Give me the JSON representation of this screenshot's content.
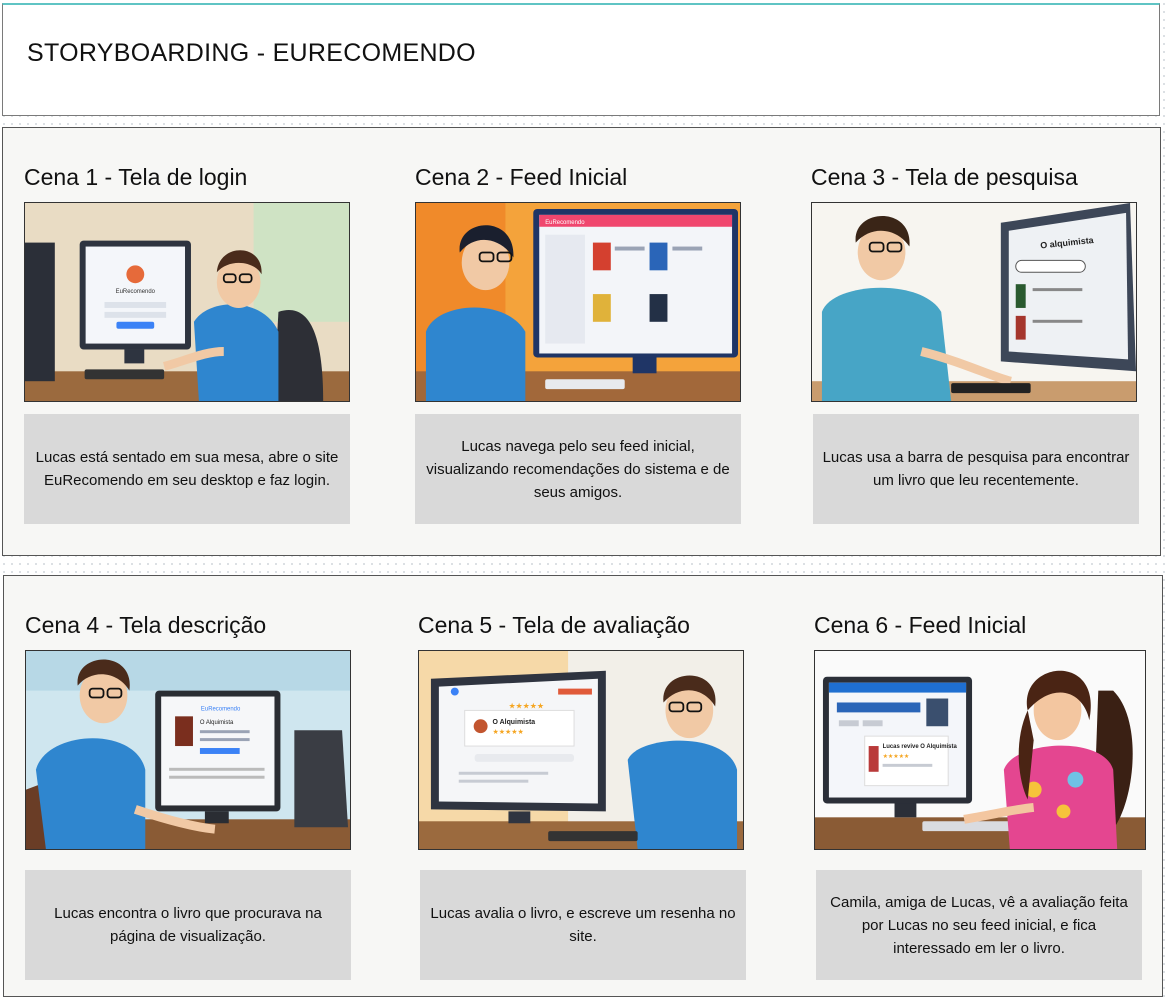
{
  "page": {
    "title": "STORYBOARDING - EURECOMENDO"
  },
  "scenes": [
    {
      "title": "Cena 1 - Tela de login",
      "caption": "Lucas está sentado em sua mesa, abre o site EuRecomendo em seu desktop e faz login.",
      "screen_text": "EuRecomendo"
    },
    {
      "title": "Cena 2 - Feed Inicial",
      "caption": "Lucas navega pelo seu feed inicial, visualizando recomendações do sistema e de seus amigos.",
      "screen_text": "EuRecomendo"
    },
    {
      "title": "Cena 3 - Tela de pesquisa",
      "caption": "Lucas usa a barra de pesquisa para encontrar um livro que leu recentemente.",
      "screen_text": "O alquimista"
    },
    {
      "title": "Cena 4 - Tela descrição",
      "caption": "Lucas encontra o livro que procurava na página de visualização.",
      "screen_text": "O Alquimista"
    },
    {
      "title": "Cena 5 - Tela de avaliação",
      "caption": "Lucas avalia o livro, e escreve um resenha no site.",
      "screen_text": "O Alquimista"
    },
    {
      "title": "Cena 6 - Feed Inicial",
      "caption": "Camila, amiga de Lucas, vê a avaliação feita por Lucas no seu feed inicial, e fica interessado em ler o livro.",
      "screen_text": "Lucas revive O Alquimista"
    }
  ]
}
